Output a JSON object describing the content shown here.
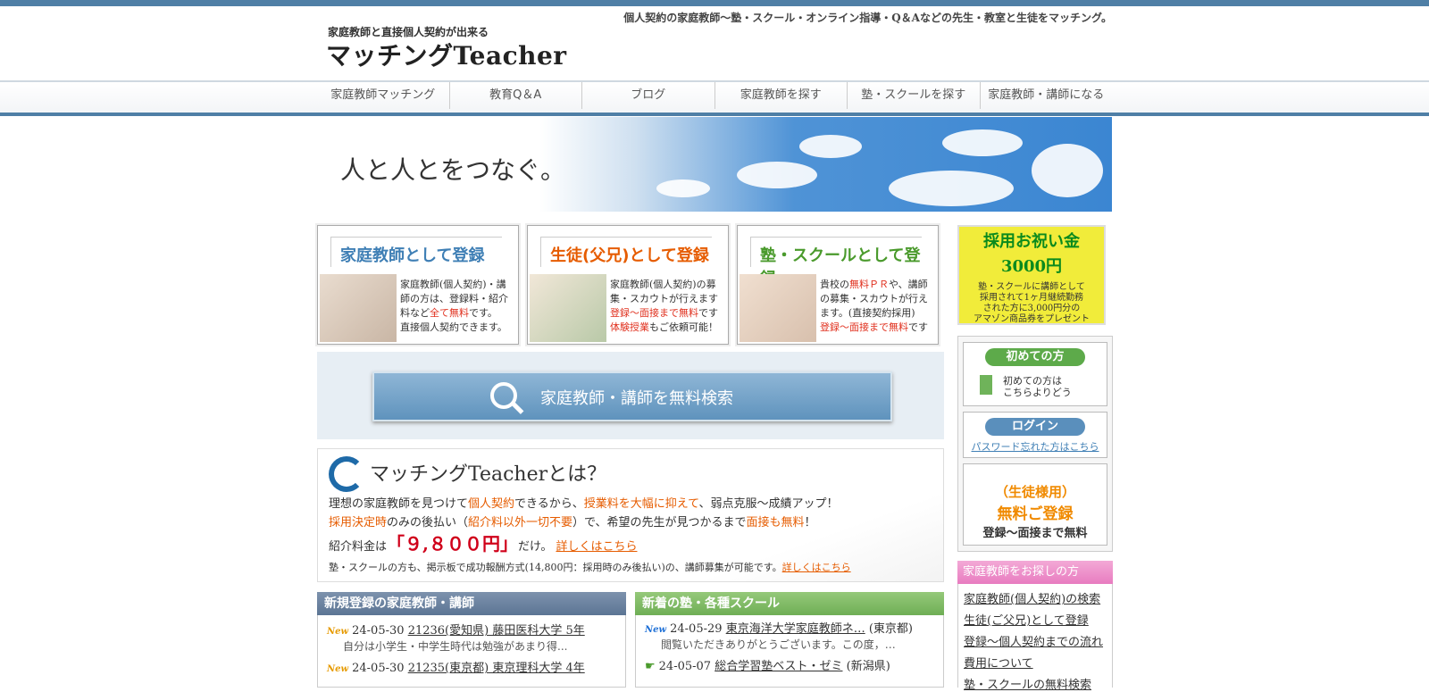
{
  "header": {
    "tagline": "個人契約の家庭教師〜塾・スクール・オンライン指導・Q＆Aなどの先生・教室と生徒をマッチング。",
    "logo_sub": "家庭教師と直接個人契約が出来る",
    "logo_main": "マッチングTeacher"
  },
  "nav": {
    "items": [
      "家庭教師マッチング",
      "教育Q＆A",
      "ブログ",
      "家庭教師を探す",
      "塾・スクールを探す",
      "家庭教師・講師になる"
    ]
  },
  "hero": {
    "text": "人と人とをつなぐ。"
  },
  "register_cards": [
    {
      "title": "家庭教師として登録",
      "title_color": "#3f7fb5",
      "lines": [
        "家庭教師(個人契約)・講",
        "師の方は、登録料・紹介",
        "料など",
        "全て無料",
        "です。",
        "直接個人契約できます。"
      ]
    },
    {
      "title": "生徒(父兄)として登録",
      "title_color": "#e65c00",
      "lines": [
        "家庭教師(個人契約)の募",
        "集・スカウトが行えます",
        "登録〜面接まで無料",
        "です",
        "体験授業",
        "もご依頼可能！"
      ]
    },
    {
      "title": "塾・スクールとして登録",
      "title_color": "#4a9a2c",
      "lines": [
        "貴校の",
        "無料ＰＲ",
        "や、講師",
        "の募集・スカウトが行え",
        "ます。(直接契約採用)",
        "登録〜面接まで無料",
        "です"
      ]
    }
  ],
  "search": {
    "label": "家庭教師・講師を無料検索"
  },
  "about": {
    "title": "マッチングTeacherとは？",
    "line1": [
      "理想の家庭教師を見つけて",
      "個人契約",
      "できるから、",
      "授業料を大幅に抑えて",
      "、弱点克服〜成績アップ！"
    ],
    "line2": [
      "採用決定時",
      "のみの後払い（",
      "紹介料以外一切不要",
      "）で、希望の先生が見つかるまで",
      "面接も無料",
      "！"
    ],
    "line3": [
      "紹介料金は",
      "「９,８００円」",
      "だけ。",
      "詳しくはこちら"
    ],
    "small": [
      "塾・スクールの方も、掲示板で成功報酬方式(14,800円：採用時のみ後払い)の、講師募集が可能です。",
      "詳しくはこちら"
    ]
  },
  "teachers": {
    "heading": "新規登録の家庭教師・講師",
    "entries": [
      {
        "badge": "New",
        "date": "24-05-30",
        "link": "21236(愛知県) 藤田医科大学 5年",
        "desc": "自分は小学生・中学生時代は勉強があまり得..."
      },
      {
        "badge": "New",
        "date": "24-05-30",
        "link": "21235(東京都) 東京理科大学 4年",
        "desc": ""
      }
    ]
  },
  "schools": {
    "heading": "新着の塾・各種スクール",
    "entries": [
      {
        "badge": "New",
        "date": "24-05-29",
        "link": "東京海洋大学家庭教師ネ…",
        "area": "(東京都)",
        "desc": "閲覧いただきありがとうございます。この度，…"
      },
      {
        "badge": "☛",
        "date": "24-05-07",
        "link": "総合学習塾ベスト・ゼミ",
        "area": "(新潟県)",
        "desc": ""
      }
    ]
  },
  "sidebar": {
    "banner": {
      "title1": "採用お祝い金",
      "title2": "3000円",
      "lines": [
        "塾・スクールに講師として",
        "採用されて1ヶ月継続勤務",
        "された方に3,000円分の",
        "アマゾン商品券をプレゼント"
      ]
    },
    "first": {
      "pill": "初めての方",
      "text1": "初めての方は",
      "text2": "こちらよりどう"
    },
    "login": {
      "pill": "ログイン",
      "forgot": "パスワード忘れた方はこちら"
    },
    "student": {
      "line1": "（生徒様用）",
      "line2": "無料ご登録",
      "line3": "登録〜面接まで無料"
    },
    "menu_heading": "家庭教師をお探しの方",
    "menu": [
      "家庭教師(個人契約)の検索",
      "生徒(ご父兄)として登録",
      "登録〜個人契約までの流れ",
      "費用について",
      "塾・スクールの無料検索"
    ]
  }
}
